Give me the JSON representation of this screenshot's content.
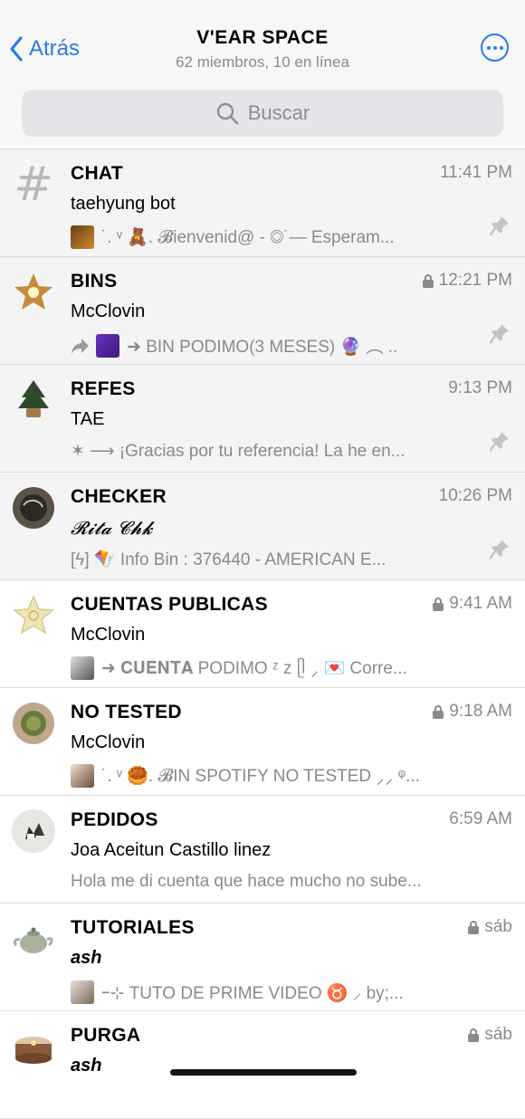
{
  "header": {
    "back_label": "Atrás",
    "title": "V'EAR SPACE",
    "subtitle": "62 miembros, 10 en línea",
    "search_placeholder": "Buscar"
  },
  "chats": [
    {
      "name": "CHAT",
      "time": "11:41 PM",
      "sender": "taehyung bot",
      "preview": "˙. ᵛ 🧸. 𝓑ienvenid@ - ◎˙— Esperam...",
      "locked": false,
      "pinned": true,
      "avatar": "hash-icon"
    },
    {
      "name": "BINS",
      "time": "12:21 PM",
      "sender": "McClovin",
      "preview": "➜ BIN PODIMO(3 MESES) 🔮 ︵ ..",
      "locked": true,
      "pinned": true,
      "avatar": "star-candle-avatar"
    },
    {
      "name": "REFES",
      "time": "9:13 PM",
      "sender": "TAE",
      "preview": "✶ ⟶ ¡Gracias por tu referencia! La he en...",
      "locked": false,
      "pinned": true,
      "avatar": "tree-avatar"
    },
    {
      "name": "CHECKER",
      "time": "10:26 PM",
      "sender": "𝓡𝓲𝓽𝓪 𝓒𝓱𝓴",
      "preview": "[ϟ] 🪁 Info Bin : 376440 - AMERICAN E...",
      "locked": false,
      "pinned": true,
      "avatar": "bowl-avatar"
    },
    {
      "name": "CUENTAS PUBLICAS",
      "time": "9:41 AM",
      "sender": "McClovin",
      "preview": "➜ 𝐂𝐔𝐄𝐍𝐓𝐀 PODIMO ᶻ z ᥫ ⸝ 💌 Corre...",
      "locked": true,
      "pinned": false,
      "avatar": "star-avatar"
    },
    {
      "name": "NO TESTED",
      "time": "9:18 AM",
      "sender": "McClovin",
      "preview": "˙. ᵛ 🥮. 𝓑IN SPOTIFY NO TESTED ⸝⸝ ᵠ...",
      "locked": true,
      "pinned": false,
      "avatar": "matcha-avatar"
    },
    {
      "name": "PEDIDOS",
      "time": "6:59 AM",
      "sender": "Joa Aceitun Castillo linez",
      "preview": "Hola me di cuenta que hace mucho no sube...",
      "locked": false,
      "pinned": false,
      "avatar": "onigiri-avatar"
    },
    {
      "name": "TUTORIALES",
      "time": "sáb",
      "sender": "ash",
      "preview": "ｰ⊹ TUTO DE PRIME VIDEO ♉ ⸝ by;...",
      "locked": true,
      "pinned": false,
      "avatar": "teapot-avatar"
    },
    {
      "name": "PURGA",
      "time": "sáb",
      "sender": "ash",
      "preview": "",
      "locked": true,
      "pinned": false,
      "avatar": "candle-avatar"
    }
  ],
  "colors": {
    "accent": "#2a7be4",
    "muted": "#8a8a8e",
    "pinned_bg": "#f4f4f4"
  }
}
